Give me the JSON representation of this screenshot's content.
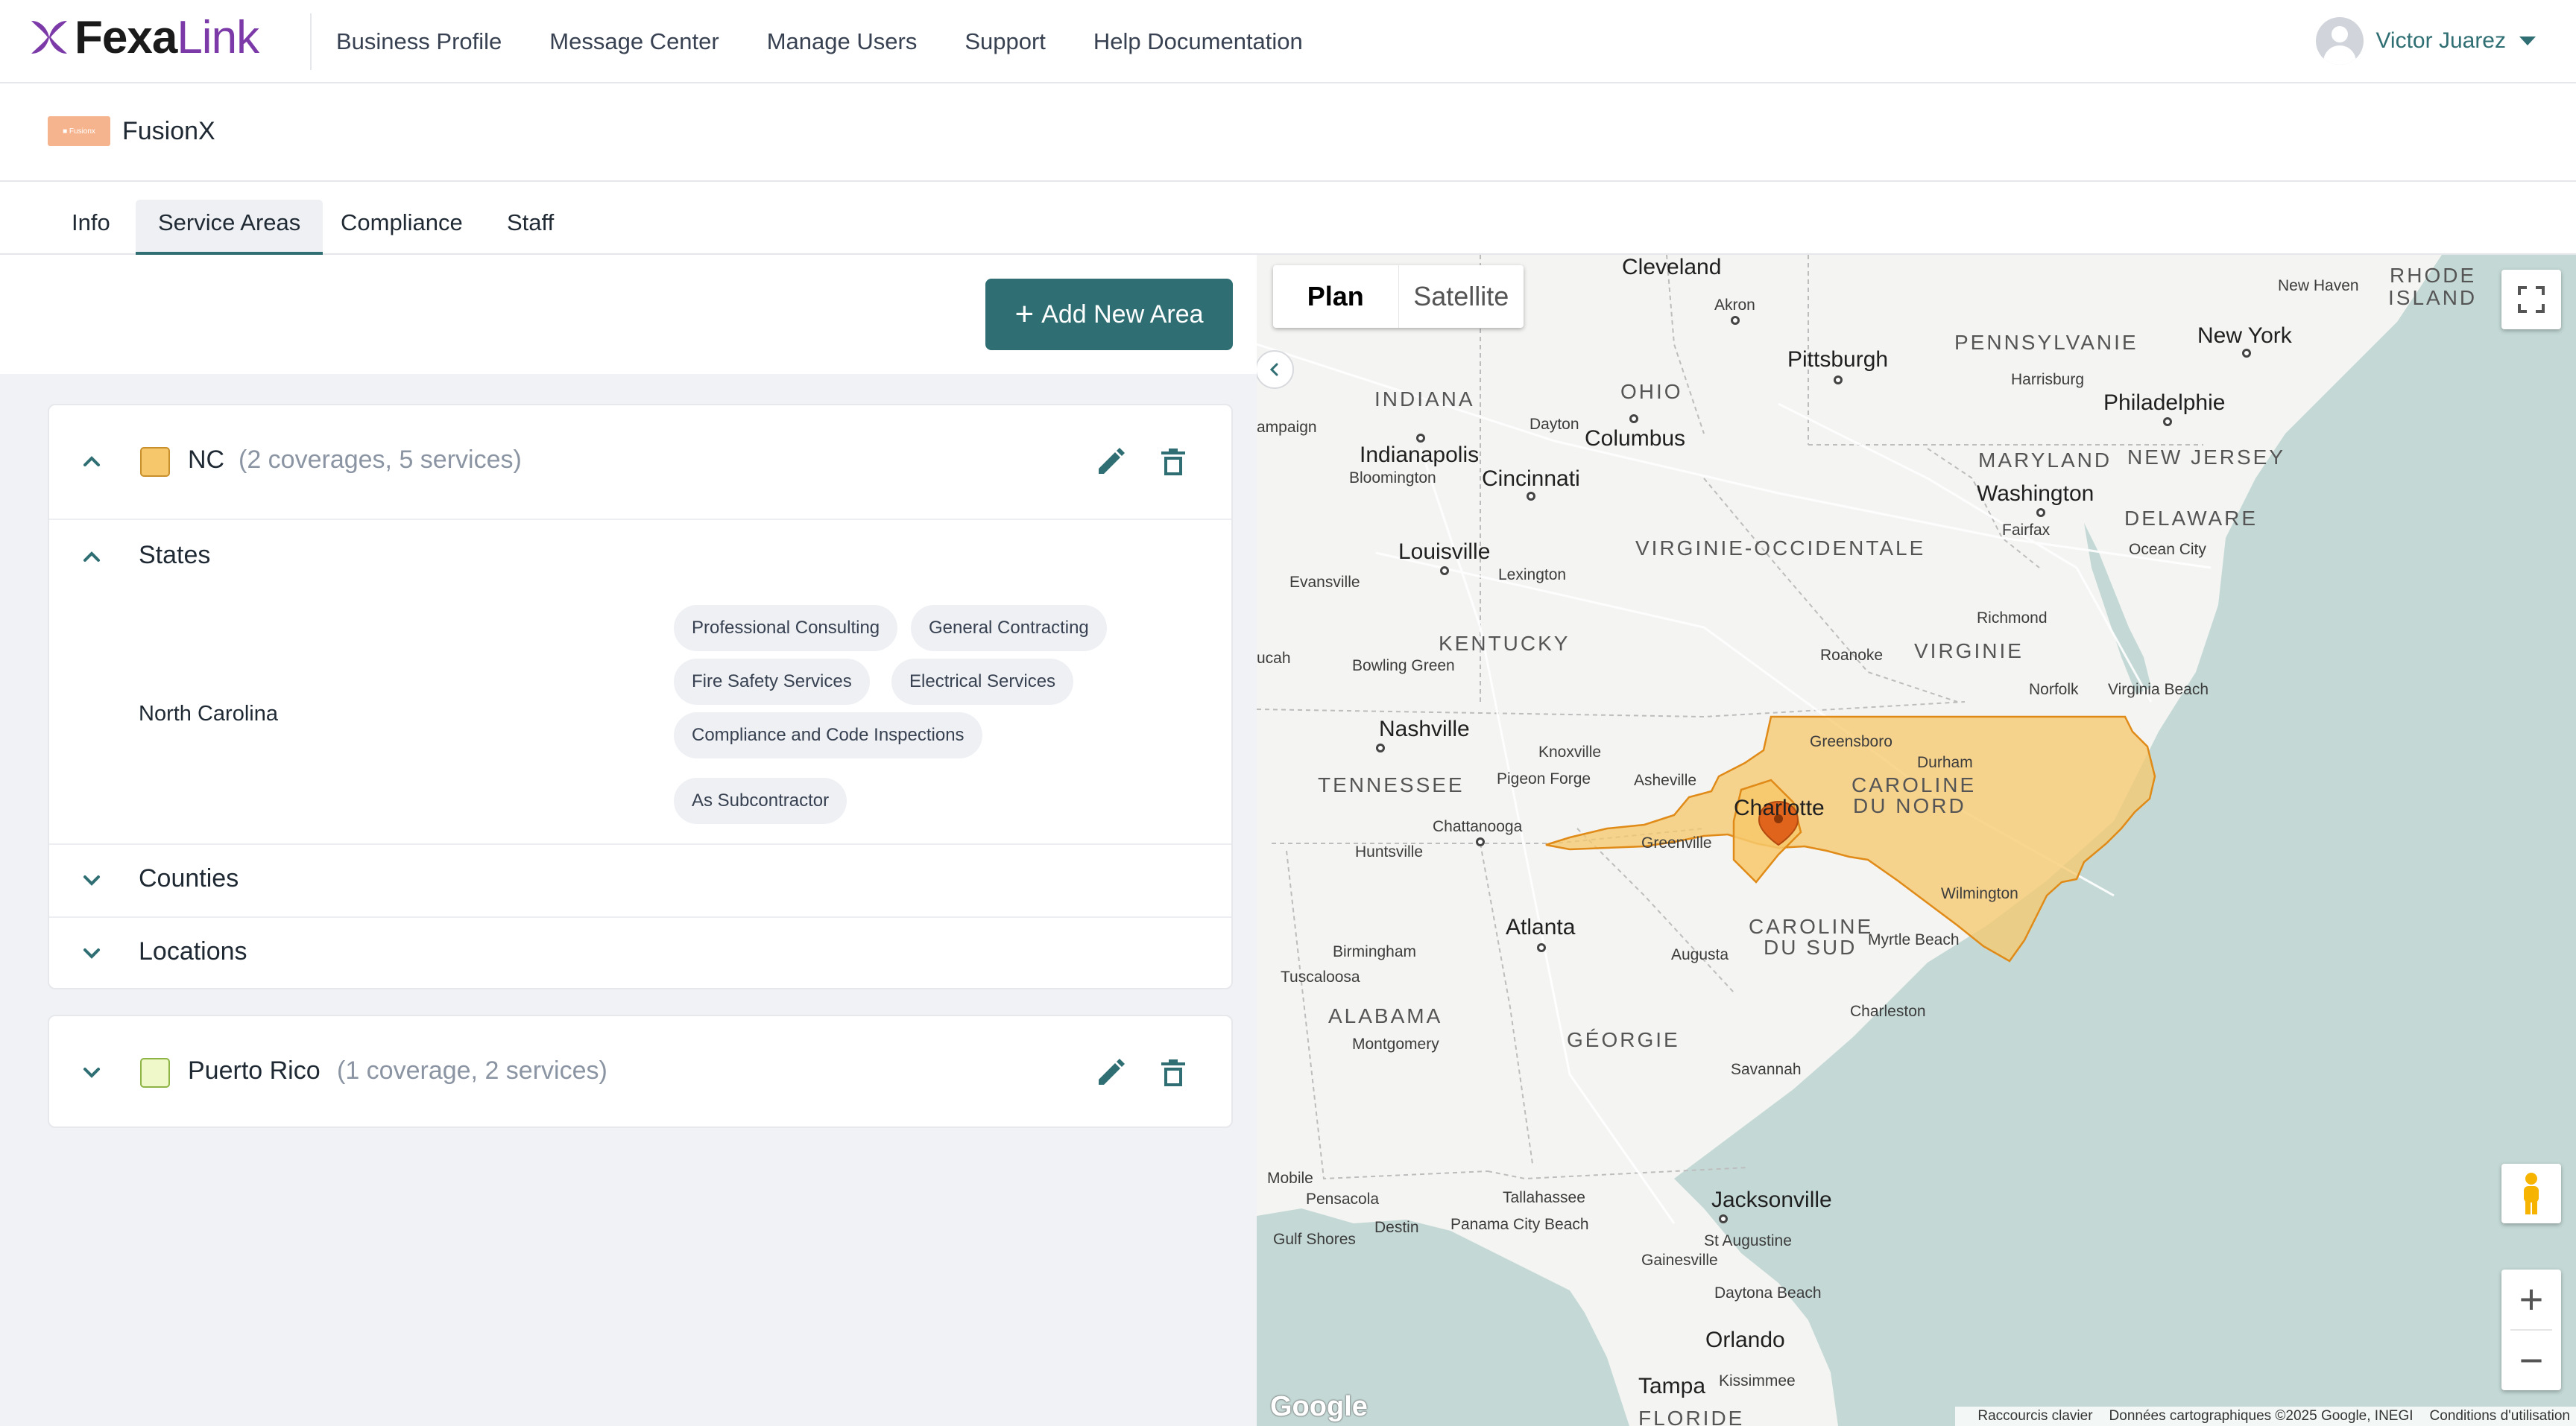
{
  "brand": {
    "part1": "Fexa",
    "part2": "Link"
  },
  "nav": [
    "Business Profile",
    "Message Center",
    "Manage Users",
    "Support",
    "Help Documentation"
  ],
  "user": {
    "name": "Victor Juarez"
  },
  "company": {
    "name": "FusionX",
    "logo_text": "■ Fusionx"
  },
  "tabs": [
    "Info",
    "Service Areas",
    "Compliance",
    "Staff"
  ],
  "active_tab": "Service Areas",
  "add_area_label": "Add New Area",
  "areas": [
    {
      "name": "NC",
      "meta": "(2 coverages, 5 services)",
      "color": "#f7c86b",
      "expanded": true,
      "sections": {
        "states": "States",
        "counties": "Counties",
        "locations": "Locations"
      },
      "state": "North Carolina",
      "services": [
        "Professional Consulting",
        "General Contracting",
        "Fire Safety Services",
        "Electrical Services",
        "Compliance and Code Inspections",
        "As Subcontractor"
      ]
    },
    {
      "name": "Puerto Rico",
      "meta": "(1 coverage, 2 services)",
      "color": "#eef8c8",
      "expanded": false
    }
  ],
  "map": {
    "type_controls": {
      "plan": "Plan",
      "satellite": "Satellite"
    },
    "selected_type": "Plan",
    "attribution": {
      "shortcuts": "Raccourcis clavier",
      "data": "Données cartographiques ©2025 Google, INEGI",
      "terms": "Conditions d'utilisation"
    },
    "google": "Google",
    "state_labels": [
      "INDIANA",
      "OHIO",
      "PENNSYLVANIE",
      "RHODE",
      "ISLAND",
      "MARYLAND",
      "NEW JERSEY",
      "DELAWARE",
      "VIRGINIE-OCCIDENTALE",
      "KENTUCKY",
      "VIRGINIE",
      "TENNESSEE",
      "CAROLINE",
      "DU NORD",
      "CAROLINE",
      "DU SUD",
      "ALABAMA",
      "GÉORGIE",
      "FLORIDE"
    ],
    "city_labels": [
      "Cleveland",
      "Akron",
      "Pittsburgh",
      "New York",
      "New Haven",
      "Harrisburg",
      "Philadelphie",
      "Indianapolis",
      "Dayton",
      "Columbus",
      "Cincinnati",
      "Bloomington",
      "Louisville",
      "Lexington",
      "Washington",
      "Fairfax",
      "Ocean City",
      "Evansville",
      "Richmond",
      "Bowling Green",
      "Roanoke",
      "Norfolk",
      "Virginia Beach",
      "Nashville",
      "Knoxville",
      "Greensboro",
      "Durham",
      "Pigeon Forge",
      "Asheville",
      "Charlotte",
      "Chattanooga",
      "Greenville",
      "Huntsville",
      "Wilmington",
      "Atlanta",
      "Augusta",
      "Myrtle Beach",
      "Birmingham",
      "Tuscaloosa",
      "Charleston",
      "Montgomery",
      "Savannah",
      "Mobile",
      "Pensacola",
      "Destin",
      "Panama City Beach",
      "Tallahassee",
      "Jacksonville",
      "St Augustine",
      "Gainesville",
      "Daytona Beach",
      "Orlando",
      "Kissimmee",
      "Tampa",
      "Gulf Shores",
      "ampaign",
      "ucah"
    ]
  }
}
